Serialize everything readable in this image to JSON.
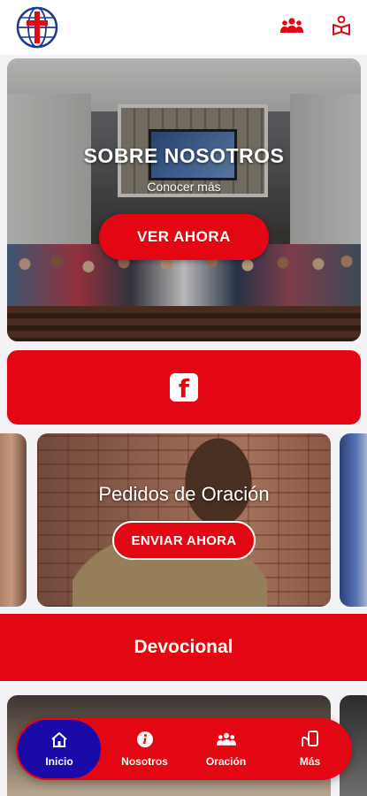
{
  "header": {
    "logo_icon": "church-cross-globe-logo",
    "right_icons": [
      "group-icon",
      "book-person-icon"
    ]
  },
  "hero": {
    "title": "SOBRE NOSOTROS",
    "subtitle": "Conocer más",
    "button_label": "VER AHORA"
  },
  "facebook": {
    "icon": "facebook-icon",
    "glyph": "f"
  },
  "carousel": {
    "active_card": {
      "title": "Pedidos de Oración",
      "button_label": "ENVIAR AHORA"
    }
  },
  "devocional": {
    "label": "Devocional"
  },
  "bottom_nav": {
    "items": [
      {
        "label": "Inicio",
        "icon": "home-icon",
        "active": true
      },
      {
        "label": "Nosotros",
        "icon": "info-icon",
        "active": false
      },
      {
        "label": "Oración",
        "icon": "group-icon",
        "active": false
      },
      {
        "label": "Más",
        "icon": "hand-phone-icon",
        "active": false
      }
    ]
  },
  "colors": {
    "primary_red": "#e30613",
    "active_blue": "#1a0aa8",
    "background": "#f3f3f6"
  }
}
